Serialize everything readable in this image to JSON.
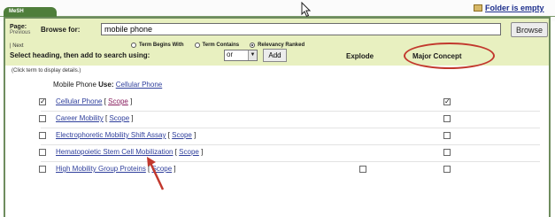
{
  "top": {
    "tab_label": "MeSH",
    "folder_label": "Folder is empty"
  },
  "search": {
    "page_label": "Page:",
    "page_sub": "Previous",
    "browse_label": "Browse for:",
    "value": "mobile phone",
    "browse_button": "Browse",
    "next_label": "| Next",
    "options": [
      {
        "label": "Term Begins With",
        "selected": false
      },
      {
        "label": "Term Contains",
        "selected": false
      },
      {
        "label": "Relevancy Ranked",
        "selected": true
      }
    ]
  },
  "controls": {
    "select_heading": "Select heading, then add to search using:",
    "operator": "or",
    "add_button": "Add",
    "explode_header": "Explode",
    "major_concept_header": "Major Concept",
    "click_help": "(Click term to display details.)"
  },
  "uses_line": {
    "prefix": "Mobile Phone",
    "use_word": "Use:",
    "term": "Cellular Phone"
  },
  "rows": [
    {
      "term": "Cellular Phone",
      "scope": "Scope",
      "checked": true,
      "explode_checkbox": false,
      "explode_checked": false,
      "major_checked": true
    },
    {
      "term": "Career Mobility",
      "scope": "Scope",
      "checked": false,
      "explode_checkbox": false,
      "explode_checked": false,
      "major_checked": false
    },
    {
      "term": "Electrophoretic Mobility Shift Assay",
      "scope": "Scope",
      "checked": false,
      "explode_checkbox": false,
      "explode_checked": false,
      "major_checked": false
    },
    {
      "term": "Hematopoietic Stem Cell Mobilization",
      "scope": "Scope",
      "checked": false,
      "explode_checkbox": false,
      "explode_checked": false,
      "major_checked": false
    },
    {
      "term": "High Mobility Group Proteins",
      "scope": "Scope",
      "checked": false,
      "explode_checkbox": true,
      "explode_checked": false,
      "major_checked": false
    }
  ],
  "colors": {
    "panel_green": "#e8f0c0",
    "border_green": "#6e8c5e",
    "link_blue": "#2f3f9c",
    "highlight_red": "#c2382d"
  }
}
